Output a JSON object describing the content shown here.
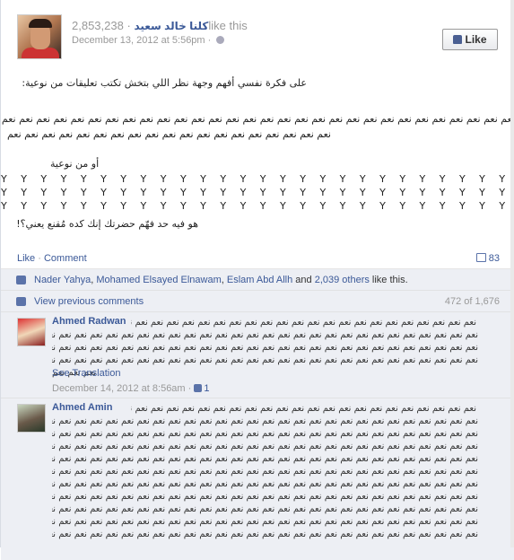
{
  "post": {
    "page_name": "كلنا خالد سعيد",
    "likes_count": "2,853,238",
    "like_this": "like this",
    "timestamp": "December 13, 2012 at 5:56pm",
    "dot": "·",
    "like_button_label": "Like",
    "para1": "على فكرة نفسي أفهم وجهة نظر اللي بتخش تكتب تعليقات من نوعية:",
    "naam_line1": "نعم نعم نعم نعم نعم نعم نعم نعم نعم نعم نعم نعم نعم نعم نعم نعم نعم نعم نعم نعم نعم نعم نعم نعم نعم نعم نعم نعم نعم نعم نعم نعم نعم",
    "naam_line2": "نعم نعم نعم نعم نعم نعم نعم نعم نعم نعم نعم نعم نعم نعم نعم نعم نعم نعم نعم",
    "or_type": "أو من نوعية",
    "y_row": "Y Y Y Y Y Y Y Y Y Y Y Y Y Y Y Y Y Y Y Y Y Y Y Y Y Y Y Y Y Y Y Y Y Y Y Y Y Y Y Y Y Y Y Y",
    "question": "هو فيه حد فهّم حضرتك إنك كده مُقنع يعني؟!"
  },
  "actions": {
    "like": "Like",
    "sep": "·",
    "comment": "Comment",
    "comment_count": "83"
  },
  "likes_row": {
    "name1": "Nader Yahya",
    "comma1": ", ",
    "name2": "Mohamed Elsayed Elnawam",
    "comma2": ", ",
    "name3": "Eslam Abd Allh",
    "and": " and ",
    "others": "2,039 others",
    "tail": " like this."
  },
  "view_previous": {
    "label": "View previous comments",
    "pager": "472 of 1,676"
  },
  "comments": [
    {
      "author": "Ahmed Radwan",
      "lines": [
        "نعم نعم نعم نعم نعم نعم نعم نعم نعم نعم نعم نعم نعم نعم نعم نعم نعم نعم نعم نعم نعم نعم نعم نعم نعم نعم نعم نعم نعم",
        "نعم نعم نعم نعم نعم نعم نعم نعم نعم نعم نعم نعم نعم نعم نعم نعم نعم نعم نعم نعم نعم نعم نعم نعم نعم نعم نعم نعم نعم",
        "نعم نعم نعم نعم نعم نعم نعم نعم نعم نعم نعم نعم نعم نعم نعم نعم نعم نعم نعم نعم نعم نعم نعم نعم نعم نعم نعم نعم نعم",
        "نعم نعم نعم نعم نعم نعم نعم نعم نعم نعم نعم نعم نعم نعم نعم نعم نعم نعم نعم نعم نعم نعم نعم نعم نعم نعم نعم نعم",
        "نعم نعم نعم"
      ],
      "see_translation": "See Translation",
      "timestamp": "December 14, 2012 at 8:56am",
      "dot": "·",
      "likes": "1"
    },
    {
      "author": "Ahmed Amin",
      "lines": [
        "نعم نعم نعم نعم نعم نعم نعم نعم نعم نعم نعم نعم نعم نعم نعم نعم نعم نعم نعم نعم نعم نعم نعم",
        "نعم نعم نعم نعم نعم نعم نعم نعم نعم نعم نعم نعم نعم نعم نعم نعم نعم نعم نعم نعم نعم نعم نعم نعم نعم نعم نعم نعم نعم",
        "نعم نعم نعم نعم نعم نعم نعم نعم نعم نعم نعم نعم نعم نعم نعم نعم نعم نعم نعم نعم نعم نعم نعم نعم نعم نعم نعم نعم نعم",
        "نعم نعم نعم نعم نعم نعم نعم نعم نعم نعم نعم نعم نعم نعم نعم نعم نعم نعم نعم نعم نعم نعم نعم نعم نعم نعم نعم نعم نعم",
        "نعم نعم نعم نعم نعم نعم نعم نعم نعم نعم نعم نعم نعم نعم نعم نعم نعم نعم نعم نعم نعم نعم نعم نعم نعم نعم نعم نعم نعم",
        "نعم نعم نعم نعم نعم نعم نعم نعم نعم نعم نعم نعم نعم نعم نعم نعم نعم نعم نعم نعم نعم نعم نعم نعم نعم نعم نعم نعم نعم",
        "نعم نعم نعم نعم نعم نعم نعم نعم نعم نعم نعم نعم نعم نعم نعم نعم نعم نعم نعم نعم نعم نعم نعم نعم نعم نعم نعم نعم نعم",
        "نعم نعم نعم نعم نعم نعم نعم نعم نعم نعم نعم نعم نعم نعم نعم نعم نعم نعم نعم نعم نعم نعم نعم نعم نعم نعم نعم نعم نعم",
        "نعم نعم نعم نعم نعم نعم نعم نعم نعم نعم نعم نعم نعم نعم نعم نعم نعم نعم نعم نعم نعم نعم نعم نعم نعم نعم نعم نعم نعم",
        "نعم نعم نعم نعم نعم نعم نعم نعم نعم نعم نعم نعم نعم نعم نعم نعم نعم نعم نعم نعم نعم نعم نعم نعم نعم نعم نعم نعم نعم",
        "نعم نعم نعم نعم نعم نعم نعم نعم نعم نعم نعم نعم نعم نعم نعم نعم نعم نعم نعم نعم نعم نعم نعم نعم نعم نعم نعم نعم نعم"
      ]
    }
  ],
  "colors": {
    "link": "#3b5998",
    "ufi_bg": "#edeff4",
    "muted": "#999999"
  }
}
